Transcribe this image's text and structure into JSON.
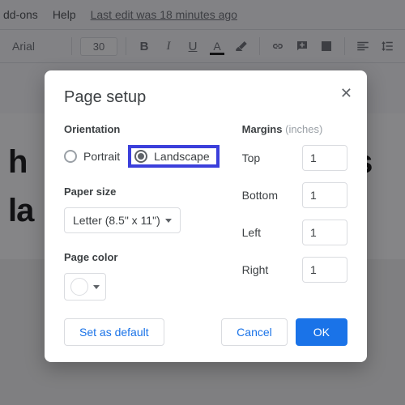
{
  "menubar": {
    "addons": "dd-ons",
    "help": "Help",
    "edit_info": "Last edit was 18 minutes ago"
  },
  "toolbar": {
    "font_name": "Arial",
    "font_size": "30"
  },
  "doc": {
    "line1": "h",
    "line1b": "ocs",
    "line2": "la"
  },
  "dialog": {
    "title": "Page setup",
    "orientation_label": "Orientation",
    "portrait": "Portrait",
    "landscape": "Landscape",
    "paper_size_label": "Paper size",
    "paper_size_value": "Letter (8.5\" x 11\")",
    "page_color_label": "Page color",
    "margins_label": "Margins",
    "margins_hint": "(inches)",
    "top": "Top",
    "bottom": "Bottom",
    "left": "Left",
    "right": "Right",
    "top_v": "1",
    "bottom_v": "1",
    "left_v": "1",
    "right_v": "1",
    "set_default": "Set as default",
    "cancel": "Cancel",
    "ok": "OK"
  }
}
